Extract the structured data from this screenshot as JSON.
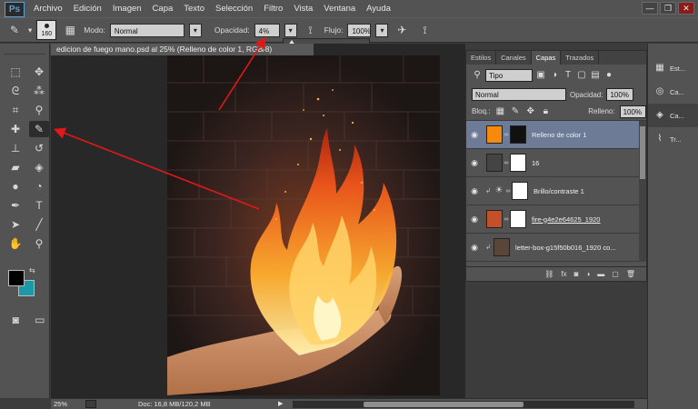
{
  "app": {
    "logo": "Ps"
  },
  "menu": [
    "Archivo",
    "Edición",
    "Imagen",
    "Capa",
    "Texto",
    "Selección",
    "Filtro",
    "Vista",
    "Ventana",
    "Ayuda"
  ],
  "window_controls": {
    "minimize": "—",
    "restore": "❐",
    "close": "✕"
  },
  "options": {
    "brush_size": "160",
    "mode_label": "Modo:",
    "mode_value": "Normal",
    "opacity_label": "Opacidad:",
    "opacity_value": "4%",
    "opacity_fraction": 0.04,
    "flow_label": "Flujo:",
    "flow_value": "100%"
  },
  "document": {
    "tab_title": "edicion de fuego mano.psd al 25% (Relleno de color 1, RGB/8)"
  },
  "colors": {
    "foreground": "#000000",
    "background": "#1a9aa8",
    "accent_selected": "#6e7b96"
  },
  "status": {
    "zoom": "25%",
    "doc_info": "Doc: 16,8 MB/120,2 MB",
    "arrow": "▶"
  },
  "layers_panel": {
    "tabs": [
      "Estilos",
      "Canales",
      "Capas",
      "Trazados"
    ],
    "active_tab": "Capas",
    "filter_value": "Tipo",
    "blend_mode": "Normal",
    "opacity_label": "Opacidad:",
    "opacity_value": "100%",
    "lock_label": "Bloq.:",
    "fill_label": "Relleno:",
    "fill_value": "100%",
    "layers": [
      {
        "name": "Relleno de color 1",
        "thumb_color": "#f58a0f",
        "mask": "dark-blob",
        "selected": true
      },
      {
        "name": "16",
        "thumb_color": "#444444",
        "mask": "white",
        "selected": false
      },
      {
        "name": "Brillo/contraste 1",
        "thumb_color": "adjustment",
        "mask": "white",
        "selected": false
      },
      {
        "name": "fire-g4e2e64625_1920",
        "thumb_color": "#c4502a",
        "mask": "white",
        "selected": false
      },
      {
        "name": "letter-box-g15f50b016_1920 co...",
        "thumb_color": "#5a4638",
        "mask": "none",
        "selected": false
      }
    ],
    "footer_icons": [
      "link-icon",
      "fx-icon",
      "mask-icon",
      "adjustment-icon",
      "folder-icon",
      "new-layer-icon",
      "trash-icon"
    ]
  },
  "dock": [
    {
      "label": "Est...",
      "icon": "styles-icon"
    },
    {
      "label": "Ca...",
      "icon": "channels-icon"
    },
    {
      "label": "Ca...",
      "icon": "layers-icon"
    },
    {
      "label": "Tr...",
      "icon": "paths-icon"
    }
  ]
}
